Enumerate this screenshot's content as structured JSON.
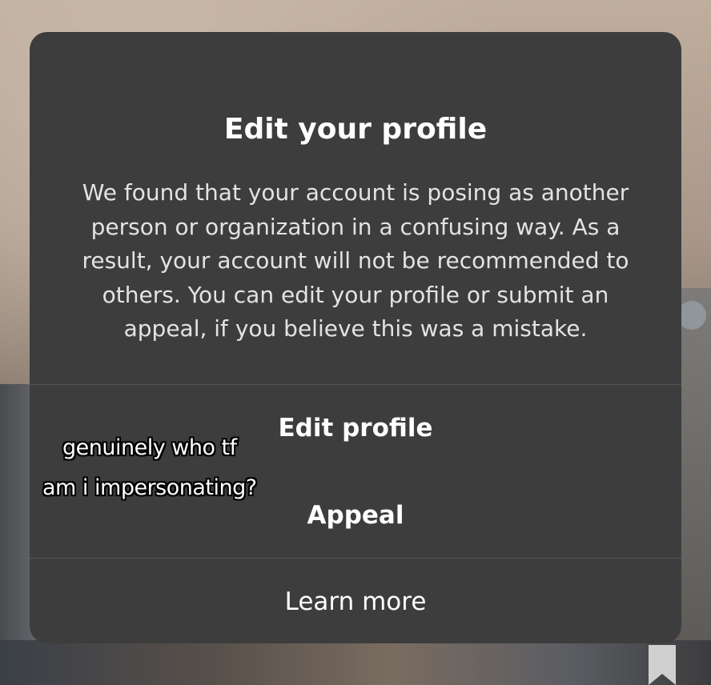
{
  "dialog": {
    "title": "Edit your profile",
    "body": "We found that your account is posing as another person or organization in a confusing way. As a result, your account will not be recommended to others. You can edit your profile or submit an appeal, if you believe this was a mistake.",
    "actions": {
      "edit_profile": "Edit profile",
      "appeal": "Appeal",
      "learn_more": "Learn more"
    }
  },
  "caption_overlay": {
    "line1": "genuinely who tf",
    "line2": "am i impersonating?"
  },
  "colors": {
    "dialog_background": "#3d3d3d",
    "text_primary": "#ffffff",
    "text_secondary": "#e3e3e3",
    "divider": "#555555"
  }
}
